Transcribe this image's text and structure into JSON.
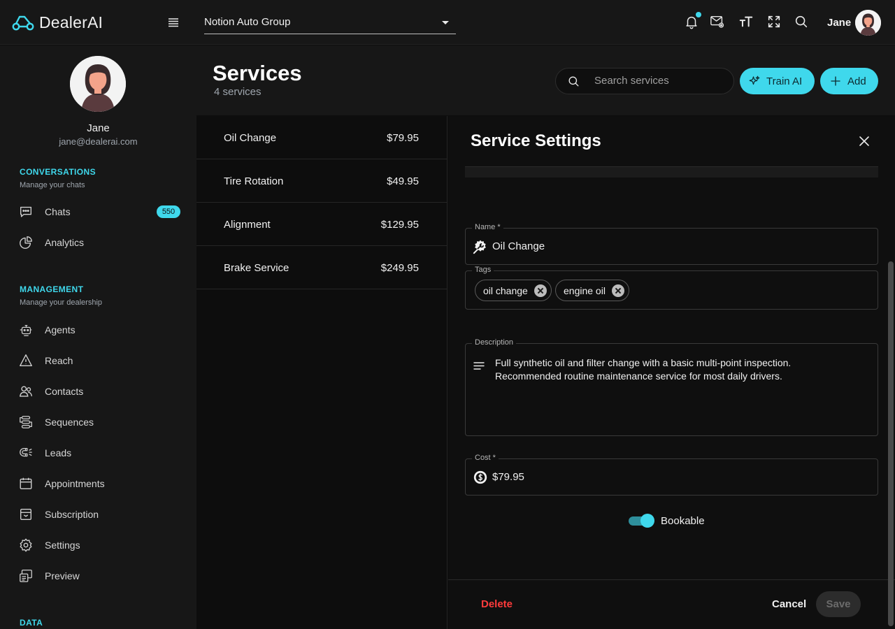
{
  "app": {
    "name": "DealerAI"
  },
  "topbar": {
    "org_select": "Notion Auto Group",
    "user_name": "Jane",
    "icons": [
      "bell-icon",
      "mail-settings-icon",
      "font-size-icon",
      "fullscreen-icon",
      "search-icon"
    ]
  },
  "sidebar": {
    "user_name": "Jane",
    "user_email": "jane@dealerai.com",
    "sections": [
      {
        "title": "CONVERSATIONS",
        "subtitle": "Manage your chats"
      },
      {
        "title": "MANAGEMENT",
        "subtitle": "Manage your dealership"
      },
      {
        "title": "DATA"
      }
    ],
    "items": [
      {
        "label": "Chats",
        "icon": "chat-icon",
        "badge": "550"
      },
      {
        "label": "Analytics",
        "icon": "pie-chart-icon"
      },
      {
        "label": "Agents",
        "icon": "agents-icon"
      },
      {
        "label": "Reach",
        "icon": "reach-icon"
      },
      {
        "label": "Contacts",
        "icon": "contacts-icon"
      },
      {
        "label": "Sequences",
        "icon": "sequences-icon"
      },
      {
        "label": "Leads",
        "icon": "magnet-icon"
      },
      {
        "label": "Appointments",
        "icon": "calendar-icon"
      },
      {
        "label": "Subscription",
        "icon": "subscription-icon"
      },
      {
        "label": "Settings",
        "icon": "gear-icon"
      },
      {
        "label": "Preview",
        "icon": "preview-icon"
      }
    ]
  },
  "header": {
    "title": "Services",
    "count": "4 services",
    "search_placeholder": "Search services",
    "train_label": "Train AI",
    "add_label": "Add"
  },
  "services": [
    {
      "name": "Oil Change",
      "price": "$79.95"
    },
    {
      "name": "Tire Rotation",
      "price": "$49.95"
    },
    {
      "name": "Alignment",
      "price": "$129.95"
    },
    {
      "name": "Brake Service",
      "price": "$249.95"
    }
  ],
  "panel": {
    "title": "Service Settings",
    "name_label": "Name *",
    "name_value": "Oil Change",
    "tags_label": "Tags",
    "tags": [
      "oil change",
      "engine oil"
    ],
    "description_label": "Description",
    "description_value": "Full synthetic oil and filter change with a basic multi-point inspection. Recommended routine maintenance service for most daily drivers.",
    "cost_label": "Cost *",
    "cost_value": "$79.95",
    "bookable_label": "Bookable",
    "bookable": true,
    "delete_label": "Delete",
    "cancel_label": "Cancel",
    "save_label": "Save"
  },
  "colors": {
    "accent": "#3fd8ec",
    "danger": "#ff3b3b",
    "background": "#0d0d0d",
    "surface": "#171717"
  }
}
